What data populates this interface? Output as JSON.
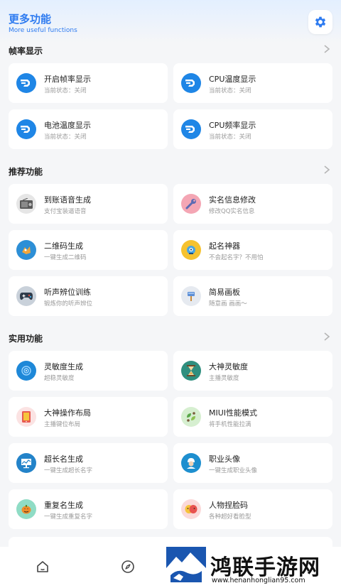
{
  "header": {
    "title": "更多功能",
    "subtitle": "More useful functions"
  },
  "sections": [
    {
      "title": "帧率显示",
      "items": [
        {
          "title": "开启帧率显示",
          "subtitle": "当前状态：关闭",
          "icon": "dashboard-icon"
        },
        {
          "title": "CPU温度显示",
          "subtitle": "当前状态：关闭",
          "icon": "dashboard-icon"
        },
        {
          "title": "电池温度显示",
          "subtitle": "当前状态：关闭",
          "icon": "dashboard-icon"
        },
        {
          "title": "CPU频率显示",
          "subtitle": "当前状态：关闭",
          "icon": "dashboard-icon"
        }
      ]
    },
    {
      "title": "推荐功能",
      "items": [
        {
          "title": "到账语音生成",
          "subtitle": "支付宝装逼语音",
          "icon": "radio-icon"
        },
        {
          "title": "实名信息修改",
          "subtitle": "修改QQ实名信息",
          "icon": "wrench-icon"
        },
        {
          "title": "二维码生成",
          "subtitle": "一键生成二维码",
          "icon": "qrcode-icon"
        },
        {
          "title": "起名神器",
          "subtitle": "不会起名字？不用怕",
          "icon": "robot-icon"
        },
        {
          "title": "听声辨位训练",
          "subtitle": "锻炼你的听声辨位",
          "icon": "gamepad-icon"
        },
        {
          "title": "简易画板",
          "subtitle": "随意画 画画～",
          "icon": "brush-icon"
        }
      ]
    },
    {
      "title": "实用功能",
      "items": [
        {
          "title": "灵敏度生成",
          "subtitle": "超稳灵敏度",
          "icon": "target-icon"
        },
        {
          "title": "大神灵敏度",
          "subtitle": "主播灵敏度",
          "icon": "hourglass-icon"
        },
        {
          "title": "大神操作布局",
          "subtitle": "主播键位布局",
          "icon": "tablet-icon"
        },
        {
          "title": "MIUI性能模式",
          "subtitle": "将手机性能拉满",
          "icon": "leaf-icon"
        },
        {
          "title": "超长名生成",
          "subtitle": "一键生成超长名字",
          "icon": "chart-board-icon"
        },
        {
          "title": "职业头像",
          "subtitle": "一键生成职业头像",
          "icon": "avatar-icon"
        },
        {
          "title": "重复名生成",
          "subtitle": "一键生成重复名字",
          "icon": "pumpkin-icon"
        },
        {
          "title": "人物捏脸码",
          "subtitle": "各种超好看脸型",
          "icon": "mask-icon"
        }
      ]
    }
  ],
  "tabbar": [
    "home-icon",
    "compass-icon"
  ],
  "watermark": {
    "text": "鸿联手游网",
    "url": "www.henanhonglian95.com"
  },
  "colors": {
    "accent": "#2e7bf0",
    "dashboard_blue": "#1f86e6",
    "background": "#f5f6f8"
  }
}
